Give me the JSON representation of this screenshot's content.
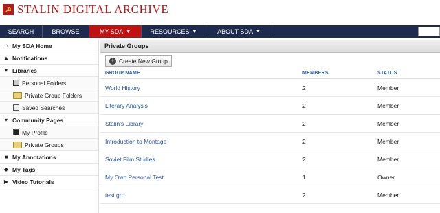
{
  "header": {
    "logo_text": "STALIN DIGITAL ARCHIVE"
  },
  "nav": {
    "items": [
      {
        "label": "SEARCH",
        "arrow": ""
      },
      {
        "label": "BROWSE",
        "arrow": ""
      },
      {
        "label": "MY SDA",
        "arrow": "▼"
      },
      {
        "label": "RESOURCES",
        "arrow": "▼"
      },
      {
        "label": "ABOUT SDA",
        "arrow": "▼"
      }
    ]
  },
  "sidebar": {
    "items": [
      {
        "label": "My SDA Home"
      },
      {
        "label": "Notifications"
      },
      {
        "label": "Libraries"
      },
      {
        "label": "Personal Folders"
      },
      {
        "label": "Private Group Folders"
      },
      {
        "label": "Saved Searches"
      },
      {
        "label": "Community Pages"
      },
      {
        "label": "My Profile"
      },
      {
        "label": "Private Groups"
      },
      {
        "label": "My Annotations"
      },
      {
        "label": "My Tags"
      },
      {
        "label": "Video Tutorials"
      }
    ]
  },
  "main": {
    "title": "Private Groups",
    "create_button": "Create New Group",
    "columns": [
      "GROUP NAME",
      "MEMBERS",
      "STATUS"
    ],
    "rows": [
      {
        "name": "World History",
        "members": "2",
        "status": "Member"
      },
      {
        "name": "Literary Analysis",
        "members": "2",
        "status": "Member"
      },
      {
        "name": "Stalin's Library",
        "members": "2",
        "status": "Member"
      },
      {
        "name": "Introduction to Montage",
        "members": "2",
        "status": "Member"
      },
      {
        "name": "Soviet Film Studies",
        "members": "2",
        "status": "Member"
      },
      {
        "name": "My Own Personal Test",
        "members": "1",
        "status": "Owner"
      },
      {
        "name": "test grp",
        "members": "2",
        "status": "Member"
      }
    ]
  },
  "colors": {
    "brand_red": "#b21c1c",
    "nav_bg": "#1e2b4e",
    "nav_active": "#c01010",
    "link_blue": "#2b57a0"
  }
}
